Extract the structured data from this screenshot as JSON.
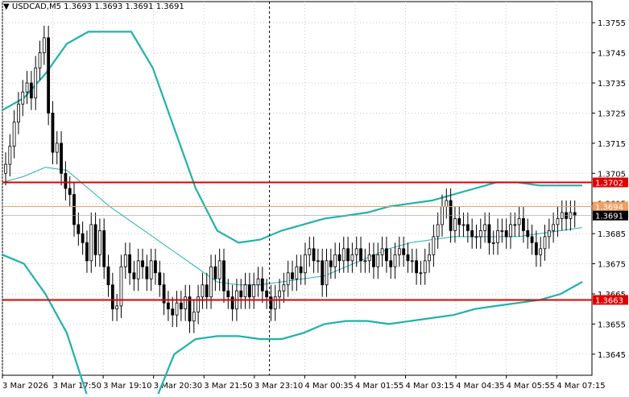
{
  "header": {
    "arrow": "▼",
    "symbol": "USDCAD,M5",
    "open": "1.3693",
    "high": "1.3693",
    "low": "1.3691",
    "close": "1.3691"
  },
  "chart_data": {
    "type": "candlestick",
    "symbol": "USDCAD",
    "timeframe": "M5",
    "title": "USDCAD,M5",
    "ylim": [
      1.3638,
      1.3762
    ],
    "y_ticks": [
      "1.3755",
      "1.3745",
      "1.3735",
      "1.3725",
      "1.3715",
      "1.3705",
      "1.3695",
      "1.3685",
      "1.3675",
      "1.3665",
      "1.3655",
      "1.3645"
    ],
    "x_ticks": [
      "3 Mar 2026",
      "3 Mar 17:50",
      "3 Mar 19:10",
      "3 Mar 20:30",
      "3 Mar 21:50",
      "3 Mar 23:10",
      "4 Mar 00:35",
      "4 Mar 01:55",
      "4 Mar 03:15",
      "4 Mar 04:35",
      "4 Mar 05:55",
      "4 Mar 07:15"
    ],
    "levels": [
      {
        "value": 1.3702,
        "label": "1.3702",
        "color": "#e00000"
      },
      {
        "value": 1.3663,
        "label": "1.3663",
        "color": "#e00000"
      },
      {
        "value": 1.3694,
        "label": "1.3694",
        "color": "#f0a060"
      },
      {
        "value": 1.3691,
        "label": "1.3691",
        "color": "#000000"
      }
    ],
    "candle_close": [
      1.3708,
      1.3714,
      1.3722,
      1.3728,
      1.3732,
      1.3735,
      1.373,
      1.374,
      1.3745,
      1.375,
      1.3725,
      1.3712,
      1.3715,
      1.3705,
      1.37,
      1.3698,
      1.3688,
      1.3685,
      1.3682,
      1.3676,
      1.3688,
      1.3678,
      1.3686,
      1.3674,
      1.3668,
      1.366,
      1.3661,
      1.3674,
      1.3678,
      1.3672,
      1.367,
      1.3676,
      1.3674,
      1.367,
      1.3676,
      1.3672,
      1.3668,
      1.3662,
      1.366,
      1.3658,
      1.3662,
      1.366,
      1.3664,
      1.3656,
      1.3659,
      1.3664,
      1.3668,
      1.3664,
      1.3674,
      1.367,
      1.3676,
      1.3666,
      1.3664,
      1.366,
      1.3666,
      1.3664,
      1.3668,
      1.3664,
      1.3668,
      1.367,
      1.3666,
      1.3664,
      1.366,
      1.3664,
      1.3666,
      1.3668,
      1.3672,
      1.367,
      1.3674,
      1.3672,
      1.3678,
      1.368,
      1.3676,
      1.3676,
      1.3668,
      1.3676,
      1.3674,
      1.3678,
      1.3676,
      1.368,
      1.3676,
      1.3678,
      1.368,
      1.3676,
      1.3676,
      1.3678,
      1.3674,
      1.3678,
      1.368,
      1.3676,
      1.3674,
      1.3678,
      1.368,
      1.3678,
      1.3676,
      1.3676,
      1.3672,
      1.3672,
      1.3676,
      1.3678,
      1.3684,
      1.3688,
      1.3694,
      1.3696,
      1.3686,
      1.369,
      1.3688,
      1.3688,
      1.3686,
      1.3684,
      1.3684,
      1.3686,
      1.3688,
      1.3682,
      1.3682,
      1.3686,
      1.3686,
      1.3684,
      1.3688,
      1.3688,
      1.369,
      1.3686,
      1.3684,
      1.3682,
      1.3678,
      1.368,
      1.3684,
      1.3686,
      1.3688,
      1.369,
      1.3692,
      1.369,
      1.3692,
      1.3691
    ],
    "bands": {
      "upper": [
        1.3726,
        1.373,
        1.3738,
        1.3748,
        1.3752,
        1.3752,
        1.3752,
        1.374,
        1.372,
        1.37,
        1.3686,
        1.3682,
        1.3683,
        1.3686,
        1.3688,
        1.369,
        1.3691,
        1.3692,
        1.3694,
        1.3695,
        1.3696,
        1.3698,
        1.37,
        1.3702,
        1.3702,
        1.3701,
        1.3701,
        1.3701
      ],
      "middle": [
        1.3702,
        1.3704,
        1.3707,
        1.3706,
        1.37,
        1.3694,
        1.3689,
        1.3684,
        1.3679,
        1.3674,
        1.3669,
        1.3668,
        1.3668,
        1.3669,
        1.367,
        1.3671,
        1.3674,
        1.3677,
        1.368,
        1.3682,
        1.3683,
        1.3684,
        1.3684,
        1.3684,
        1.3684,
        1.3685,
        1.3686,
        1.3687
      ],
      "lower": [
        1.3678,
        1.3675,
        1.3665,
        1.3652,
        1.363,
        1.36,
        1.359,
        1.362,
        1.3645,
        1.365,
        1.3651,
        1.3651,
        1.365,
        1.365,
        1.3652,
        1.3655,
        1.3656,
        1.3656,
        1.3655,
        1.3656,
        1.3657,
        1.3658,
        1.366,
        1.3661,
        1.3662,
        1.3663,
        1.3665,
        1.3669
      ]
    },
    "grid": true,
    "price_axis_position": "right"
  }
}
